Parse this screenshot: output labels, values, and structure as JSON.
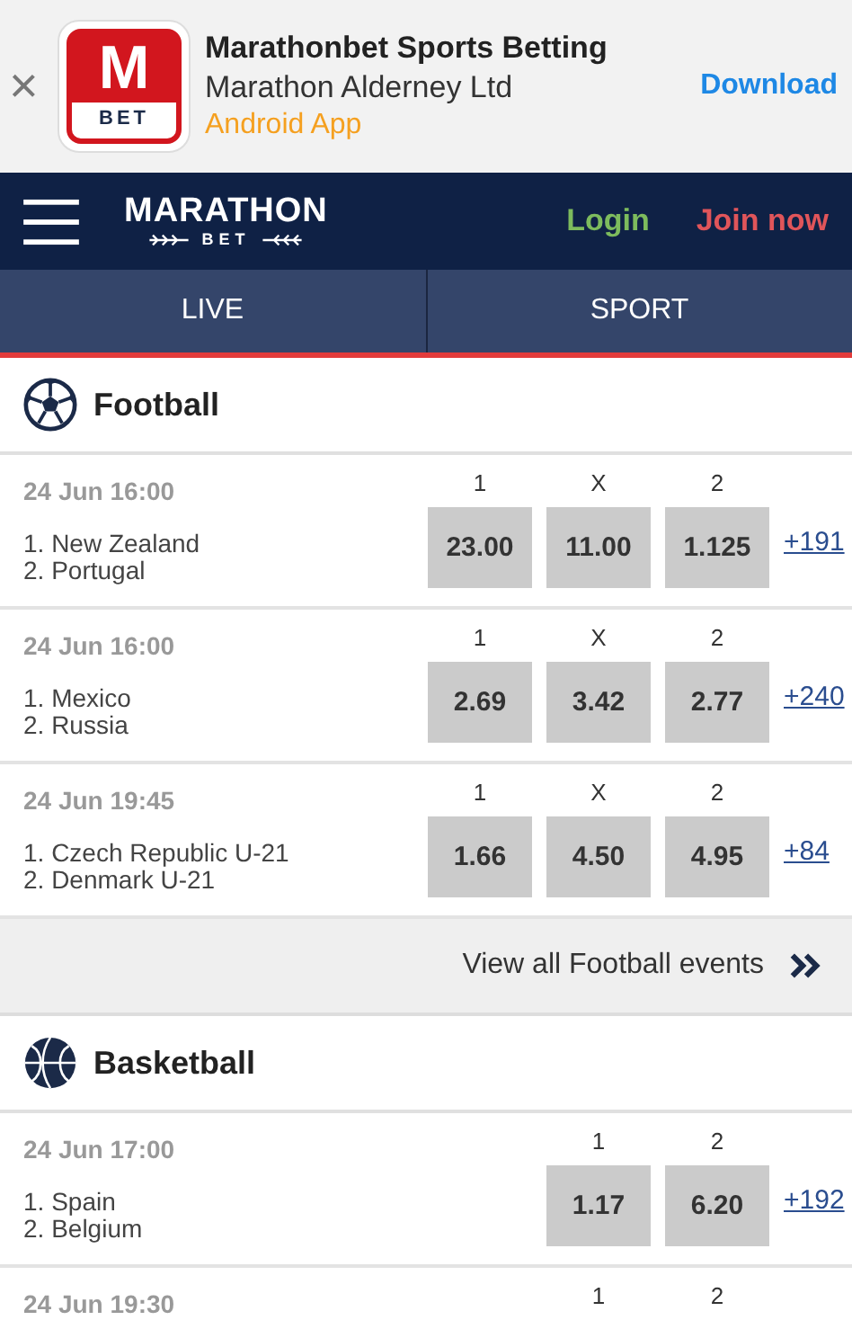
{
  "app_banner": {
    "close": "×",
    "logo_letter": "M",
    "logo_word": "BET",
    "title": "Marathonbet Sports Betting",
    "publisher": "Marathon Alderney Ltd",
    "platform": "Android App",
    "action": "Download"
  },
  "header": {
    "brand": "MARATHON",
    "brand_sub": "BET",
    "login": "Login",
    "join": "Join now"
  },
  "tabs": [
    {
      "label": "LIVE",
      "selected": false
    },
    {
      "label": "SPORT",
      "selected": false
    }
  ],
  "sections": [
    {
      "name": "Football",
      "kind": "football",
      "events": [
        {
          "date": "24 Jun 16:00",
          "teams": [
            "1. New Zealand",
            "2. Portugal"
          ],
          "odds": [
            {
              "label": "1",
              "price": "23.00"
            },
            {
              "label": "X",
              "price": "11.00"
            },
            {
              "label": "2",
              "price": "1.125"
            }
          ],
          "more": "+191"
        },
        {
          "date": "24 Jun 16:00",
          "teams": [
            "1. Mexico",
            "2. Russia"
          ],
          "odds": [
            {
              "label": "1",
              "price": "2.69"
            },
            {
              "label": "X",
              "price": "3.42"
            },
            {
              "label": "2",
              "price": "2.77"
            }
          ],
          "more": "+240"
        },
        {
          "date": "24 Jun 19:45",
          "teams": [
            "1. Czech Republic U-21",
            "2. Denmark U-21"
          ],
          "odds": [
            {
              "label": "1",
              "price": "1.66"
            },
            {
              "label": "X",
              "price": "4.50"
            },
            {
              "label": "2",
              "price": "4.95"
            }
          ],
          "more": "+84"
        }
      ],
      "view_all": "View all Football events"
    },
    {
      "name": "Basketball",
      "kind": "basketball",
      "events": [
        {
          "date": "24 Jun 17:00",
          "teams": [
            "1. Spain",
            "2. Belgium"
          ],
          "odds": [
            {
              "label": "1",
              "price": "1.17"
            },
            {
              "label": "2",
              "price": "6.20"
            }
          ],
          "more": "+192"
        },
        {
          "date": "24 Jun 19:30",
          "odds": [
            {
              "label": "1"
            },
            {
              "label": "2"
            }
          ]
        }
      ]
    }
  ]
}
